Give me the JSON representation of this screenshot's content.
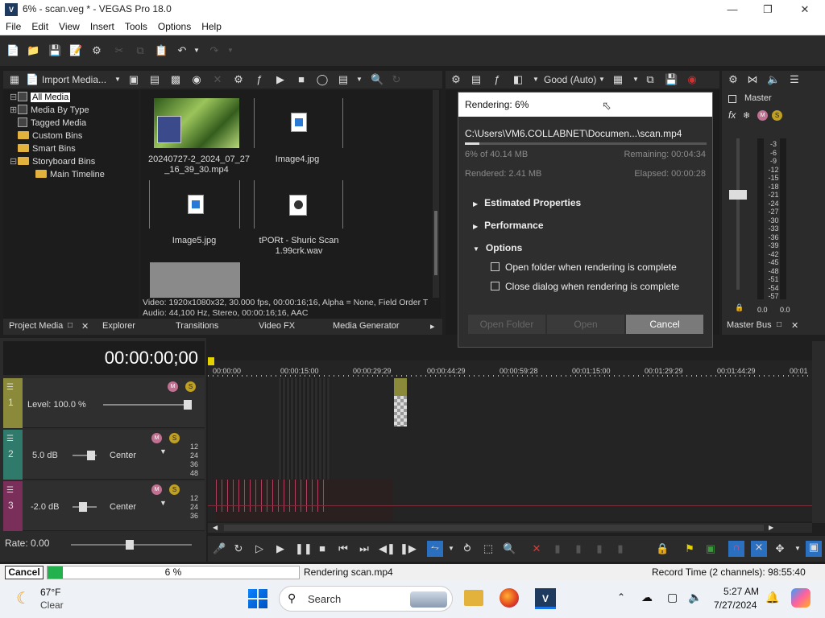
{
  "window": {
    "title": "6% - scan.veg * - VEGAS Pro 18.0",
    "logo": "V"
  },
  "menu": [
    "File",
    "Edit",
    "View",
    "Insert",
    "Tools",
    "Options",
    "Help"
  ],
  "project_media": {
    "import_label": "Import Media...",
    "tree": [
      "All Media",
      "Media By Type",
      "Tagged Media",
      "Custom Bins",
      "Smart Bins",
      "Storyboard Bins",
      "Main Timeline"
    ],
    "items": [
      {
        "name": "20240727-2_2024_07_27\n_16_39_30.mp4"
      },
      {
        "name": "Image4.jpg"
      },
      {
        "name": "Image5.jpg"
      },
      {
        "name": "tPORt - Shuric Scan\n1.99crk.wav"
      }
    ],
    "info_video": "Video: 1920x1080x32, 30.000 fps, 00:00:16;16, Alpha = None, Field Order T",
    "info_audio": "Audio: 44,100 Hz, Stereo, 00:00:16;16, AAC"
  },
  "tabs": [
    "Project Media",
    "Explorer",
    "Transitions",
    "Video FX",
    "Media Generator"
  ],
  "preview": {
    "quality": "Good (Auto)"
  },
  "mixer": {
    "label": "Master",
    "scale": [
      "3",
      "6",
      "9",
      "12",
      "15",
      "18",
      "21",
      "24",
      "27",
      "30",
      "33",
      "36",
      "39",
      "42",
      "45",
      "48",
      "51",
      "54",
      "57"
    ],
    "left_val": "0.0",
    "right_val": "0.0",
    "tab": "Master Bus"
  },
  "dialog": {
    "title": "Rendering: 6%",
    "path": "C:\\Users\\VM6.COLLABNET\\Documen...\\scan.mp4",
    "progress_pct": 6,
    "of_size": "6% of 40.14 MB",
    "remaining": "Remaining: 00:04:34",
    "rendered": "Rendered: 2.41 MB",
    "elapsed": "Elapsed: 00:00:28",
    "sections": [
      "Estimated Properties",
      "Performance",
      "Options"
    ],
    "opt1": "Open folder when rendering is complete",
    "opt2": "Close dialog when rendering is complete",
    "btn_folder": "Open Folder",
    "btn_open": "Open",
    "btn_cancel": "Cancel"
  },
  "timeline": {
    "timecode": "00:00:00;00",
    "ruler": [
      "00:00:00",
      "00:00:15:00",
      "00:00:29:29",
      "00:00:44:29",
      "00:00:59:28",
      "00:01:15:00",
      "00:01:29:29",
      "00:01:44:29",
      "00:01"
    ],
    "track1": {
      "num": "1",
      "level": "Level: 100.0 %"
    },
    "track2": {
      "num": "2",
      "db": "5.0 dB",
      "pan": "Center"
    },
    "track3": {
      "num": "3",
      "db": "-2.0 dB",
      "pan": "Center"
    },
    "meter_ticks": [
      "12",
      "24",
      "36",
      "48"
    ],
    "rate": "Rate: 0.00"
  },
  "status": {
    "cancel": "Cancel",
    "percent": "6 %",
    "progress_pct": 6,
    "rendering": "Rendering scan.mp4",
    "record_time": "Record Time (2 channels): 98:55:40"
  },
  "taskbar": {
    "temp": "67°F",
    "cond": "Clear",
    "search": "Search",
    "time": "5:27 AM",
    "date": "7/27/2024"
  }
}
